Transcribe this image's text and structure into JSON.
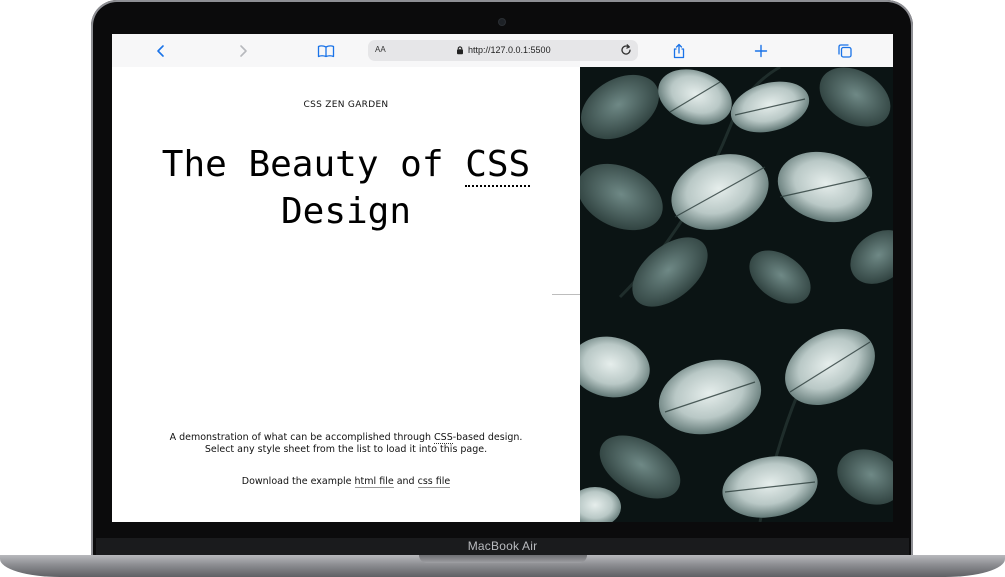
{
  "device": {
    "model_label": "MacBook Air"
  },
  "browser": {
    "text_size_label": "AA",
    "url": "http://127.0.0.1:5500"
  },
  "page": {
    "site_title": "CSS ZEN GARDEN",
    "headline_part1": "The Beauty of ",
    "headline_abbr": "CSS",
    "headline_part2": " Design",
    "intro_line1_a": "A demonstration of what can be accomplished through ",
    "intro_line1_abbr": "CSS",
    "intro_line1_b": "-based design.",
    "intro_line2": "Select any style sheet from the list to load it into this page.",
    "download_prefix": "Download the example ",
    "html_link": "html file",
    "download_and": " and ",
    "css_link": "css file"
  },
  "colors": {
    "toolbar_icon": "#1a73e8",
    "toolbar_icon_disabled": "#b7b9bd",
    "photo_leaf": "#3d5654",
    "photo_frost": "#cfdad8"
  },
  "icons": [
    "back-icon",
    "forward-icon",
    "bookmarks-icon",
    "lock-icon",
    "reload-icon",
    "share-icon",
    "new-tab-icon",
    "tabs-icon"
  ]
}
